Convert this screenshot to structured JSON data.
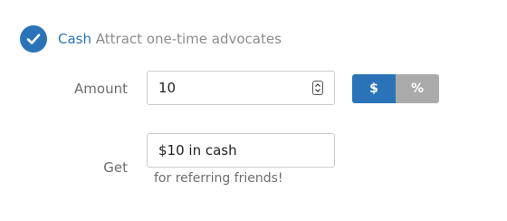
{
  "reward": {
    "name": "Cash",
    "description": "Attract one-time advocates",
    "selected": true,
    "accent_color": "#2a73b8"
  },
  "amount": {
    "label": "Amount",
    "value": "10",
    "unit_options": [
      "$",
      "%"
    ],
    "selected_unit": "$"
  },
  "get": {
    "label": "Get",
    "value": "$10 in cash",
    "help_text": "for referring friends!"
  }
}
